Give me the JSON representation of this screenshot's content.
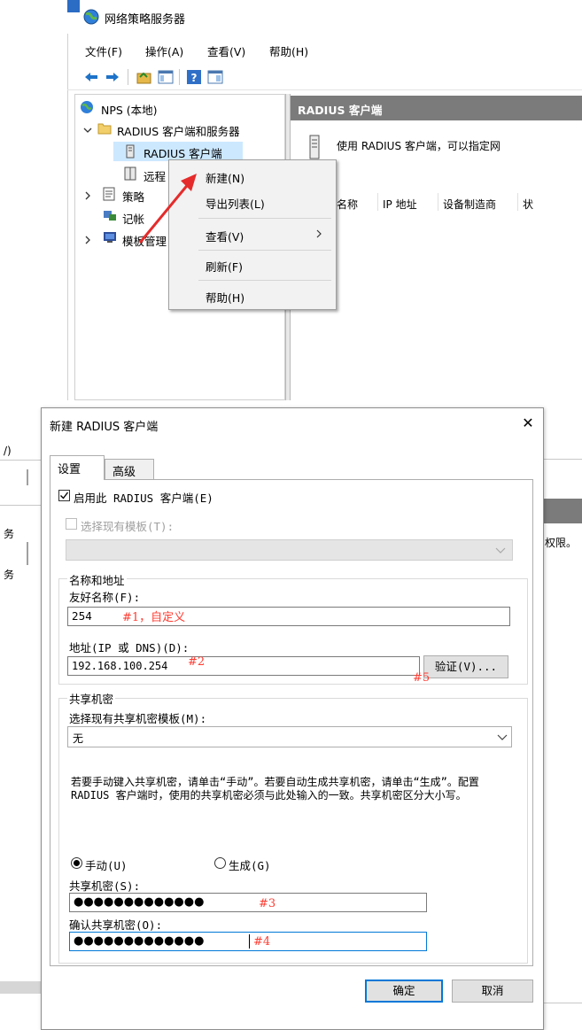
{
  "mmc": {
    "title": "网络策略服务器",
    "menu": [
      "文件(F)",
      "操作(A)",
      "查看(V)",
      "帮助(H)"
    ],
    "tree": {
      "root": "NPS (本地)",
      "radius_group": "RADIUS 客户端和服务器",
      "radius_clients": "RADIUS 客户端",
      "remote": "远程",
      "policies": "策略",
      "accounting": "记帐",
      "templates": "模板管理"
    },
    "detail": {
      "header": "RADIUS 客户端",
      "description": "使用 RADIUS 客户端，可以指定网",
      "columns": [
        "名称",
        "IP 地址",
        "设备制造商",
        "状"
      ]
    },
    "context_menu": {
      "new": "新建(N)",
      "export": "导出列表(L)",
      "view": "查看(V)",
      "refresh": "刷新(F)",
      "help": "帮助(H)"
    }
  },
  "background_fragments": {
    "left_a": "/)",
    "left_b": "务",
    "left_c": "务",
    "right_a": "权限。"
  },
  "dialog": {
    "title": "新建 RADIUS 客户端",
    "tabs": [
      "设置",
      "高级"
    ],
    "enable_label": "启用此 RADIUS 客户端(E)",
    "enable_checked": true,
    "template_label": "选择现有模板(T):",
    "template_value": "",
    "name_group_label": "名称和地址",
    "friendly_name_label": "友好名称(F):",
    "friendly_name_value": "254",
    "address_label": "地址(IP 或 DNS)(D):",
    "address_value": "192.168.100.254",
    "verify_button": "验证(V)...",
    "secret_group_label": "共享机密",
    "secret_template_label": "选择现有共享机密模板(M):",
    "secret_template_value": "无",
    "secret_help": "若要手动键入共享机密，请单击“手动”。若要自动生成共享机密，请单击“生成”。配置 RADIUS 客户端时，使用的共享机密必须与此处输入的一致。共享机密区分大小写。",
    "manual_label": "手动(U)",
    "generate_label": "生成(G)",
    "shared_secret_label": "共享机密(S):",
    "shared_secret_value": "●●●●●●●●●●●●●",
    "confirm_secret_label": "确认共享机密(O):",
    "confirm_secret_value": "●●●●●●●●●●●●●",
    "ok_button": "确定",
    "cancel_button": "取消"
  },
  "annotations": {
    "a1": "#1，自定义",
    "a2": "#2",
    "a3": "#3",
    "a4": "#4",
    "a5": "#5"
  },
  "colors": {
    "accent_blue": "#0078d7",
    "annotation_red": "#ff3b30",
    "header_gray": "#7b7b7b",
    "selection": "#cce8ff"
  }
}
